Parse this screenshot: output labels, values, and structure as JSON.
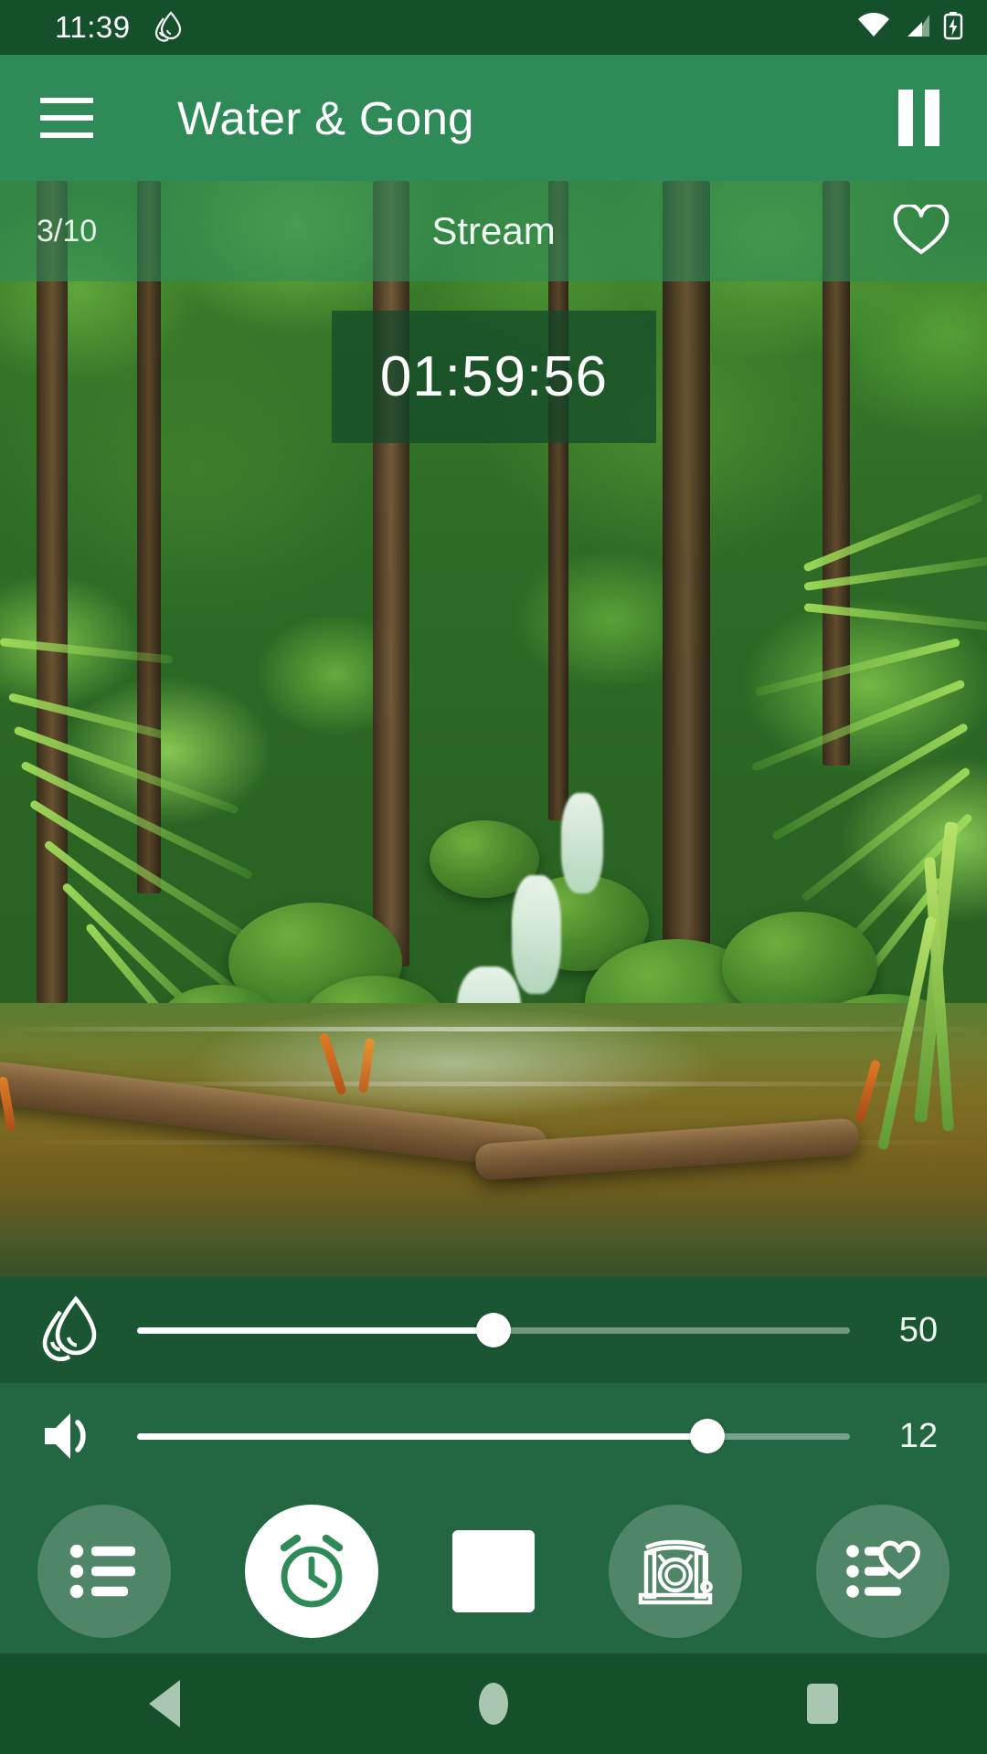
{
  "status_bar": {
    "time": "11:39",
    "notification_icon": "water-drop-icon",
    "wifi_icon": "wifi-icon",
    "signal_icon": "cellular-signal-icon",
    "battery_icon": "battery-charging-icon",
    "background_color": "#14512b"
  },
  "app_bar": {
    "menu_icon": "hamburger-menu-icon",
    "title": "Water & Gong",
    "play_pause_icon": "pause-icon",
    "background_color": "#2e8b57"
  },
  "track_header": {
    "position": "3/10",
    "title": "Stream",
    "favorite_icon": "heart-outline-icon"
  },
  "timer": {
    "value": "01:59:56"
  },
  "sliders": [
    {
      "name": "water-sound-slider",
      "icon": "water-drop-icon",
      "value": "50",
      "percent": 50
    },
    {
      "name": "volume-slider",
      "icon": "volume-speaker-icon",
      "value": "12",
      "percent": 80
    }
  ],
  "controls": [
    {
      "name": "playlist-button",
      "icon": "list-icon",
      "active": false
    },
    {
      "name": "timer-button",
      "icon": "alarm-clock-icon",
      "active": true
    },
    {
      "name": "stop-button",
      "icon": "stop-square-icon",
      "active": false
    },
    {
      "name": "gong-button",
      "icon": "gong-icon",
      "active": false
    },
    {
      "name": "favorites-button",
      "icon": "list-heart-icon",
      "active": false
    }
  ],
  "nav_bar": {
    "back_icon": "back-triangle-icon",
    "home_icon": "home-circle-icon",
    "recents_icon": "recents-square-icon"
  },
  "theme": {
    "primary_green": "#2e8b57",
    "dark_green": "#14512b",
    "white": "#ffffff"
  }
}
